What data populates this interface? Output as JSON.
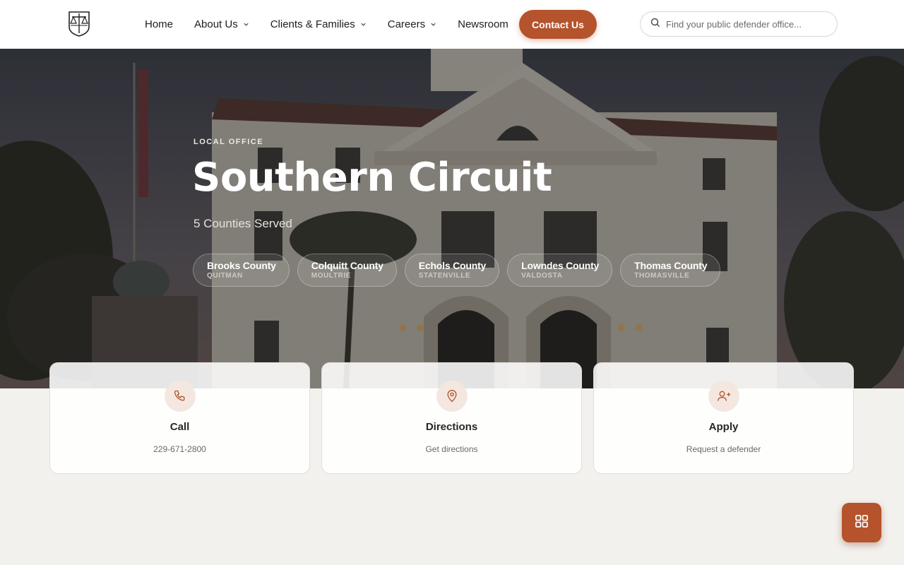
{
  "header": {
    "logo_icon": "scales-of-justice-logo",
    "nav": [
      {
        "label": "Home",
        "has_dropdown": false
      },
      {
        "label": "About Us",
        "has_dropdown": true
      },
      {
        "label": "Clients & Families",
        "has_dropdown": true
      },
      {
        "label": "Careers",
        "has_dropdown": true
      },
      {
        "label": "Newsroom",
        "has_dropdown": false
      }
    ],
    "contact_label": "Contact Us",
    "search_placeholder": "Find your public defender office..."
  },
  "hero": {
    "eyebrow": "LOCAL OFFICE",
    "title": "Southern Circuit",
    "subtitle": "5 Counties Served",
    "counties": [
      {
        "name": "Brooks County",
        "seat": "QUITMAN"
      },
      {
        "name": "Colquitt County",
        "seat": "MOULTRIE"
      },
      {
        "name": "Echols County",
        "seat": "STATENVILLE"
      },
      {
        "name": "Lowndes County",
        "seat": "VALDOSTA"
      },
      {
        "name": "Thomas County",
        "seat": "THOMASVILLE"
      }
    ]
  },
  "actions": [
    {
      "icon": "phone-icon",
      "title": "Call",
      "detail": "229-671-2800"
    },
    {
      "icon": "map-pin-icon",
      "title": "Directions",
      "detail": "Get directions"
    },
    {
      "icon": "user-plus-icon",
      "title": "Apply",
      "detail": "Request a defender"
    }
  ],
  "fab_icon": "grid-icon",
  "colors": {
    "accent": "#b4532c",
    "accent_light": "#f4e7e0",
    "page_bg": "#f3f1ed"
  }
}
